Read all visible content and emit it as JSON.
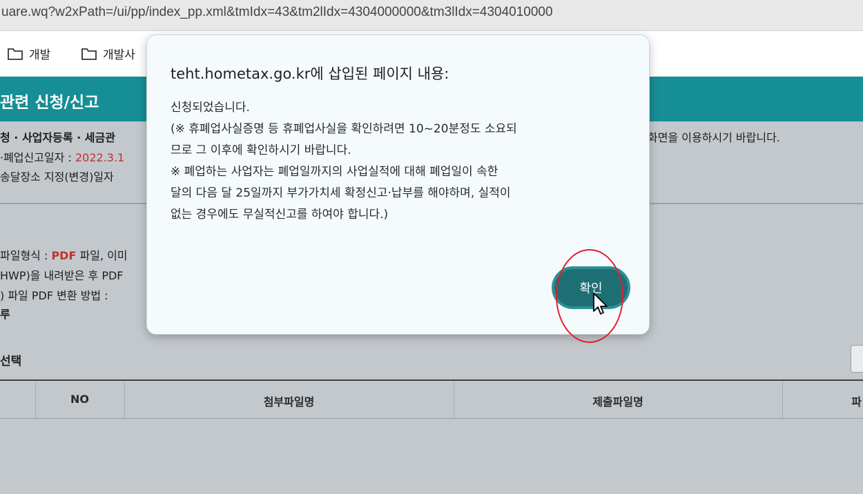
{
  "address_bar": {
    "url": "uare.wq?w2xPath=/ui/pp/index_pp.xml&tmIdx=43&tm2lIdx=4304000000&tm3lIdx=4304010000"
  },
  "bookmarks": [
    {
      "label": "개발",
      "icon": "folder-icon"
    },
    {
      "label": "개발사",
      "icon": "folder-icon"
    }
  ],
  "header": {
    "title": "관련 신청/신고"
  },
  "page": {
    "line1_left": "청 · 사업자등록 · 세금관",
    "line1_right": "화면을 이용하시기 바랍니다.",
    "line2_label": "·폐업신고일자 : ",
    "line2_value": "2022.3.1",
    "line3": "송달장소 지정(변경)일자 ",
    "file_line1_prefix": "파일형식 : ",
    "file_line1_pdf": "PDF",
    "file_line1_suffix": " 파일, 이미",
    "file_line2": "HWP)을 내려받은 후 PDF",
    "file_line3": ") 파일 PDF 변환 방법 : ",
    "file_line4": "루",
    "section_label": "선택"
  },
  "table": {
    "headers": [
      "NO",
      "첨부파일명",
      "제출파일명",
      "파"
    ]
  },
  "dialog": {
    "title": "teht.hometax.go.kr에 삽입된 페이지 내용:",
    "lines": [
      "신청되었습니다.",
      "(※ 휴폐업사실증명 등 휴폐업사실을 확인하려면 10~20분정도 소요되",
      "므로 그 이후에 확인하시기 바랍니다.",
      " ※ 폐업하는 사업자는 폐업일까지의 사업실적에 대해 폐업일이 속한",
      "달의 다음 달 25일까지 부가가치세 확정신고·납부를 해야하며, 실적이",
      "없는 경우에도 무실적신고를 하여야 합니다.)"
    ],
    "ok_label": "확인"
  },
  "colors": {
    "header_teal": "#168e96",
    "button_teal": "#1e6e76",
    "highlight_red": "#e0202a"
  }
}
